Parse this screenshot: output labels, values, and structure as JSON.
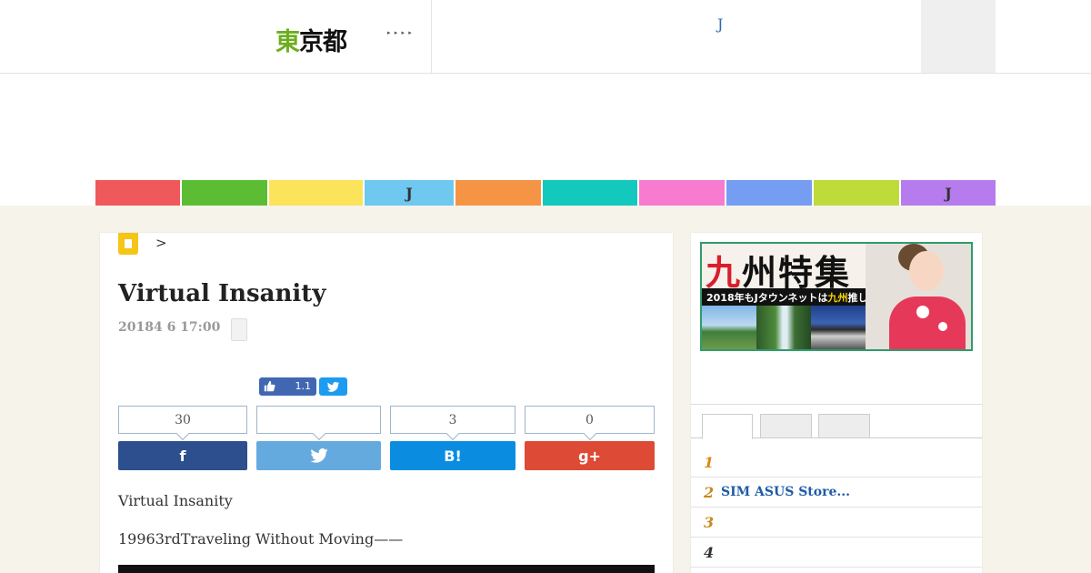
{
  "header": {
    "logo_first": "東",
    "logo_rest": "京都",
    "dots": "▸ ▸ ▸ ▸",
    "center_mark": "J"
  },
  "nav": {
    "items": [
      {
        "label": "",
        "color": "#f0595b"
      },
      {
        "label": "",
        "color": "#5cbd34"
      },
      {
        "label": "",
        "color": "#fbe35b"
      },
      {
        "label": "J",
        "color": "#6ec8f0"
      },
      {
        "label": "",
        "color": "#f59445"
      },
      {
        "label": "",
        "color": "#13c8bd"
      },
      {
        "label": "",
        "color": "#f77bcf"
      },
      {
        "label": "",
        "color": "#759ef2"
      },
      {
        "label": "",
        "color": "#bedb39"
      },
      {
        "label": "J",
        "color": "#b67ced"
      }
    ]
  },
  "breadcrumb": {
    "separator": ">"
  },
  "article": {
    "title": "Virtual Insanity",
    "date": "20184 6 17:00",
    "fb_like_count": "1.1",
    "counts": [
      "30",
      "",
      "3",
      "0"
    ],
    "paragraph1": "Virtual Insanity",
    "paragraph2": "19963rdTraveling Without Moving——"
  },
  "share": {
    "facebook_label": "f",
    "hatena_label": "B!",
    "google_label": "g+",
    "colors": {
      "facebook": "#2d4f8e",
      "twitter": "#65aadf",
      "hatena": "#0a8de0",
      "google": "#dd4a36"
    }
  },
  "banner": {
    "title_red": "九",
    "title_rest": "州特集",
    "subtitle_pre": "2018年もJタウンネットは",
    "subtitle_highlight": "九州",
    "subtitle_post": "推し！"
  },
  "ranking": {
    "items": [
      {
        "num": "1",
        "title": "",
        "color": "#d68910"
      },
      {
        "num": "2",
        "title": "SIM ASUS Store...",
        "color": "#c7891f"
      },
      {
        "num": "3",
        "title": "",
        "color": "#c7891f"
      },
      {
        "num": "4",
        "title": "",
        "color": "#333333"
      }
    ]
  }
}
